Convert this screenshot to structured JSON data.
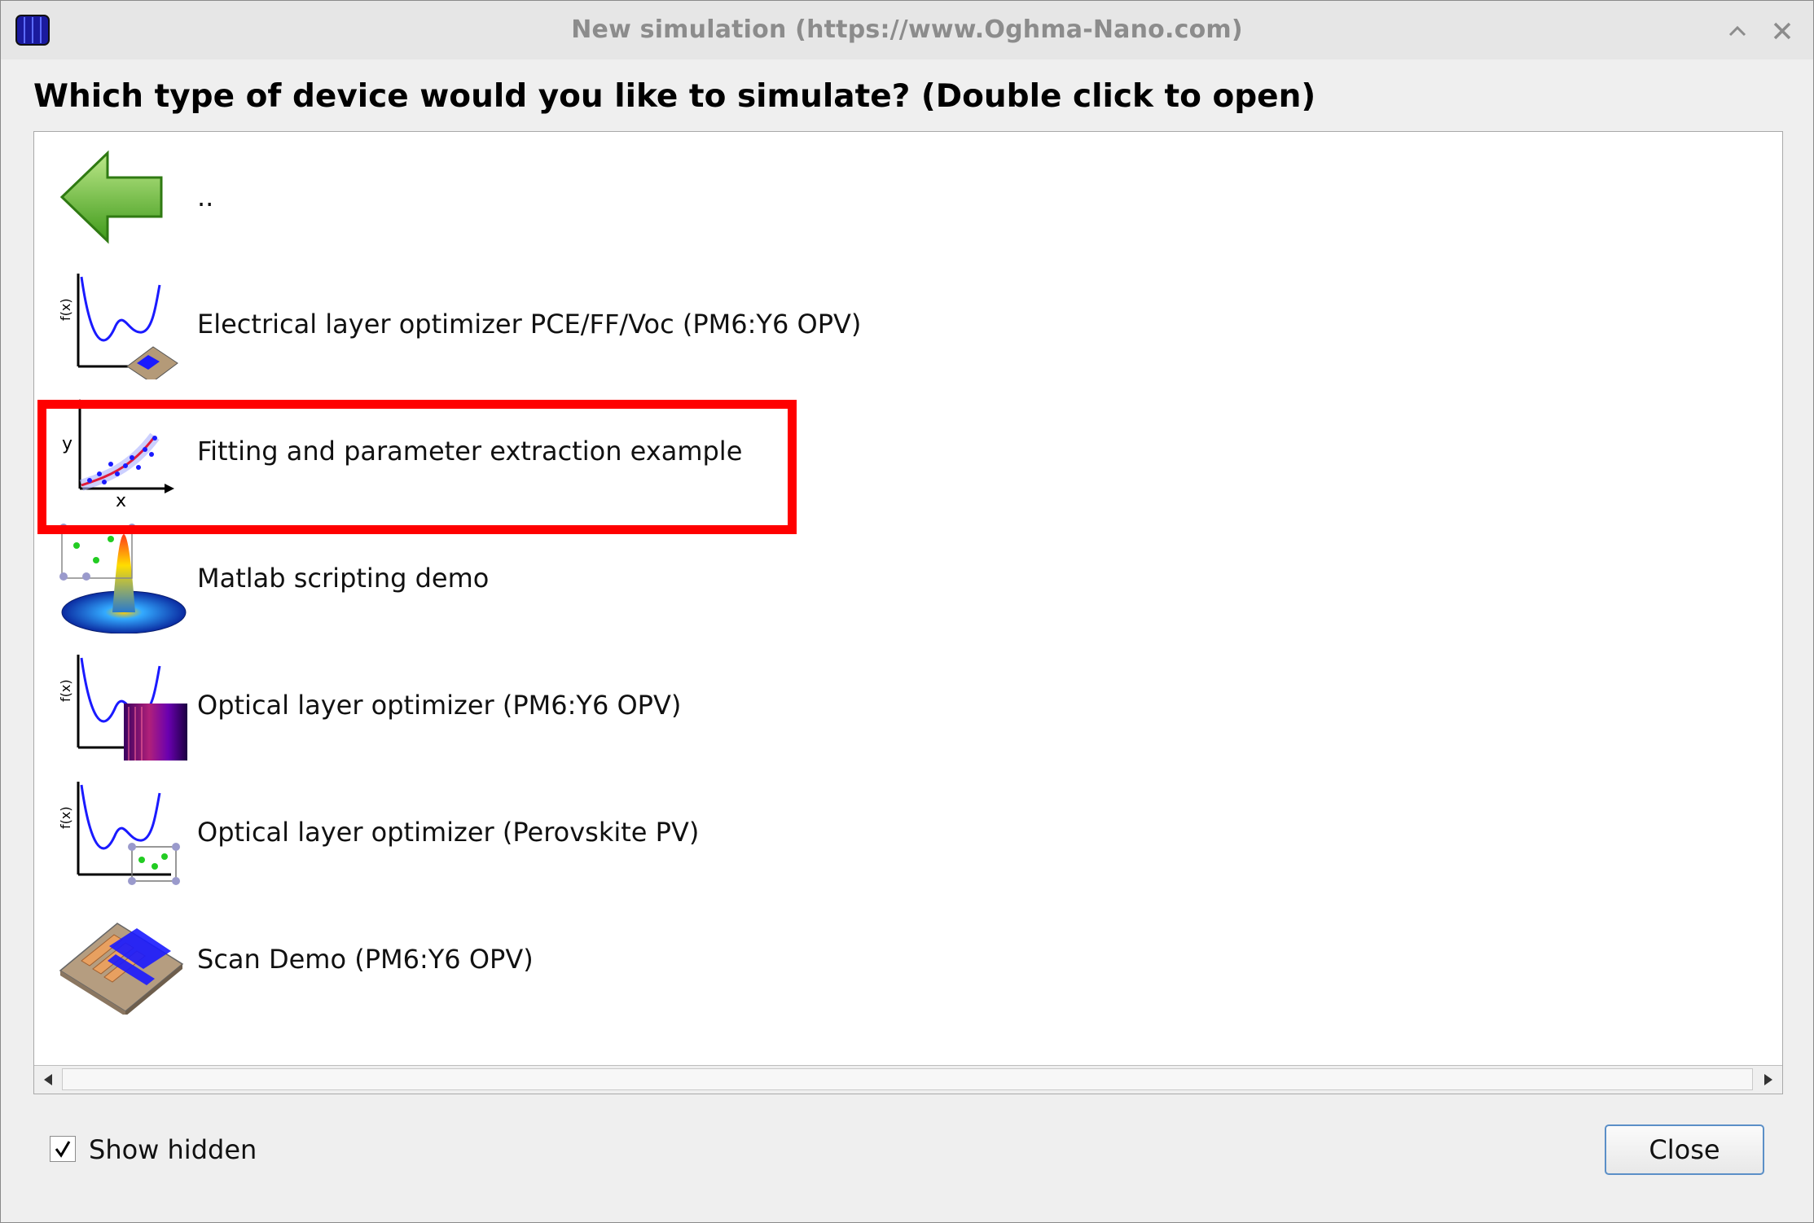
{
  "window": {
    "title": "New simulation (https://www.Oghma-Nano.com)"
  },
  "heading": "Which type of device would you like to simulate? (Double click to open)",
  "list": {
    "items": [
      {
        "label": "..",
        "icon": "back-arrow-icon"
      },
      {
        "label": "Electrical layer optimizer PCE/FF/Voc (PM6:Y6 OPV)",
        "icon": "optimizer-device-icon"
      },
      {
        "label": "Fitting and parameter extraction example",
        "icon": "fit-plot-icon",
        "highlighted": true
      },
      {
        "label": "Matlab scripting demo",
        "icon": "matlab-surface-icon"
      },
      {
        "label": "Optical layer optimizer (PM6:Y6 OPV)",
        "icon": "optimizer-optical-icon"
      },
      {
        "label": "Optical layer optimizer (Perovskite PV)",
        "icon": "optimizer-perovskite-icon"
      },
      {
        "label": "Scan Demo (PM6:Y6 OPV)",
        "icon": "device-chip-icon"
      }
    ]
  },
  "footer": {
    "show_hidden_label": "Show hidden",
    "show_hidden_checked": true,
    "close_label": "Close"
  },
  "colors": {
    "highlight": "#ff0000",
    "plot_curve": "#1a1aff",
    "button_focus_border": "#5b8fc7"
  }
}
